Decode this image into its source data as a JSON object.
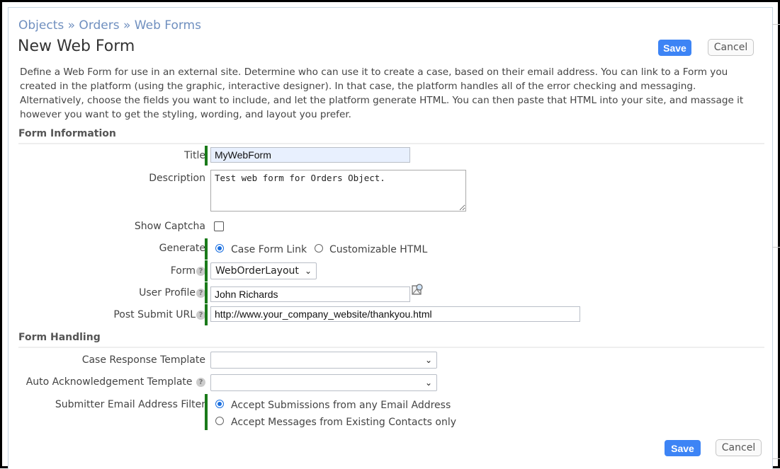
{
  "breadcrumb": "Objects » Orders » Web Forms",
  "page_title": "New Web Form",
  "buttons": {
    "save": "Save",
    "cancel": "Cancel"
  },
  "description": "Define a Web Form for use in an external site. Determine who can use it to create a case, based on their email address. You can link to a Form you created in the platform (using the graphic, interactive designer). In that case, the platform handles all of the error checking and messaging. Alternatively, choose the fields you want to include, and let the platform generate HTML. You can then paste that HTML into your site, and massage it however you want to get the styling, wording, and layout you prefer.",
  "form_information": {
    "heading": "Form Information",
    "title": {
      "label": "Title",
      "value": "MyWebForm"
    },
    "description": {
      "label": "Description",
      "value": "Test web form for Orders Object."
    },
    "show_captcha": {
      "label": "Show Captcha",
      "checked": false
    },
    "generate": {
      "label": "Generate",
      "options": [
        "Case Form Link",
        "Customizable HTML"
      ],
      "selected": "Case Form Link"
    },
    "form": {
      "label": "Form",
      "value": "WebOrderLayout"
    },
    "user_profile": {
      "label": "User Profile",
      "value": "John Richards"
    },
    "post_submit_url": {
      "label": "Post Submit URL",
      "value": "http://www.your_company_website/thankyou.html"
    }
  },
  "form_handling": {
    "heading": "Form Handling",
    "case_response_template": {
      "label": "Case Response Template",
      "value": ""
    },
    "auto_ack_template": {
      "label": "Auto Acknowledgement Template",
      "value": ""
    },
    "email_filter": {
      "label": "Submitter Email Address Filter",
      "options": [
        "Accept Submissions from any Email Address",
        "Accept Messages from Existing Contacts only"
      ],
      "selected": "Accept Submissions from any Email Address"
    }
  },
  "help_icon": "?"
}
